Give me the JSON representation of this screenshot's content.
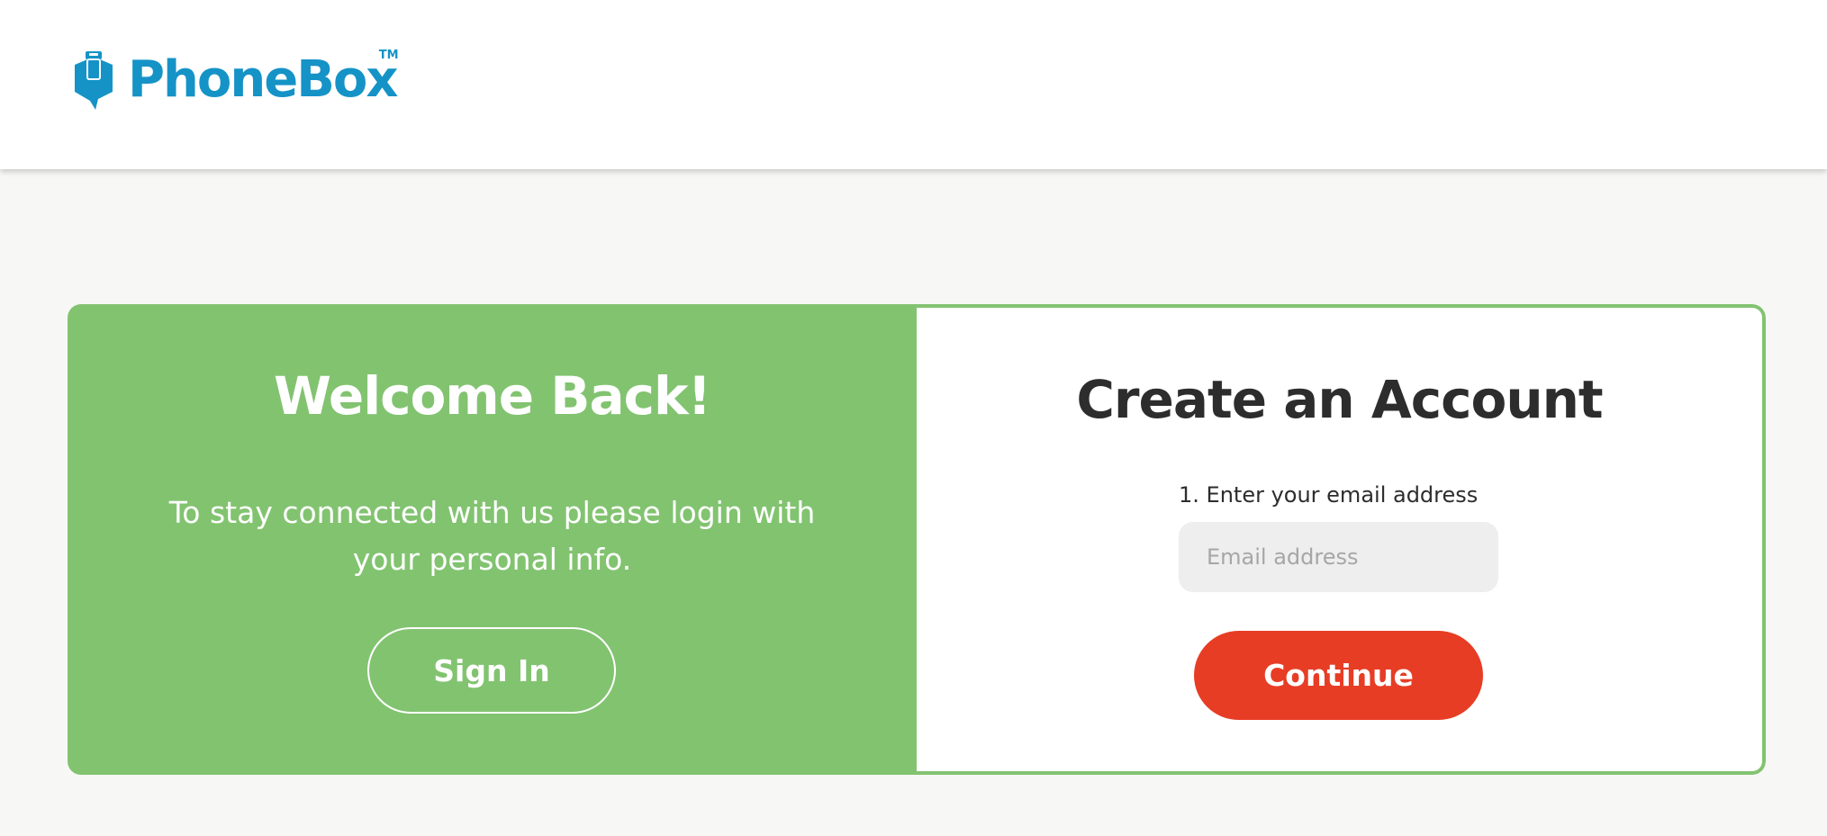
{
  "header": {
    "logo_text": "PhoneBox",
    "logo_tm": "TM"
  },
  "welcome": {
    "title": "Welcome Back!",
    "text": "To stay connected with us please login with your personal info.",
    "signin_label": "Sign In"
  },
  "signup": {
    "title": "Create an Account",
    "step_label": "1. Enter your email address",
    "email_placeholder": "Email address",
    "email_value": "",
    "continue_label": "Continue"
  },
  "colors": {
    "brand_blue": "#1593c7",
    "green": "#82c370",
    "red": "#e73d25",
    "dark_text": "#2d2d2d",
    "background": "#f7f8f6"
  },
  "icons": {
    "logo": "phone-tag-icon"
  }
}
